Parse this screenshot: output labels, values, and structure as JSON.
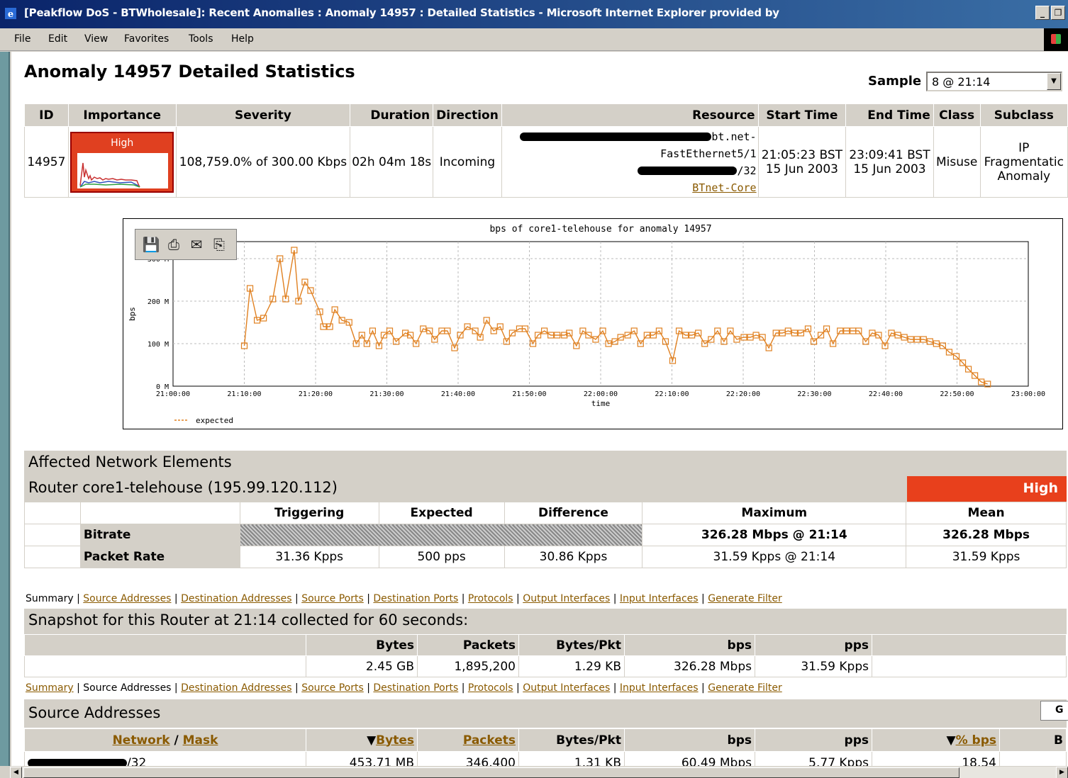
{
  "window": {
    "title": "[Peakflow DoS - BTWholesale]: Recent Anomalies : Anomaly 14957 : Detailed Statistics - Microsoft Internet Explorer provided by",
    "controls": [
      "_",
      "×"
    ]
  },
  "menu": [
    "File",
    "Edit",
    "View",
    "Favorites",
    "Tools",
    "Help"
  ],
  "page": {
    "title": "Anomaly 14957 Detailed Statistics",
    "sample_label": "Sample",
    "sample_value": "8 @ 21:14"
  },
  "anomaly": {
    "headers": [
      "ID",
      "Importance",
      "Severity",
      "Duration",
      "Direction",
      "Resource",
      "Start Time",
      "End Time",
      "Class",
      "Subclass"
    ],
    "id": "14957",
    "importance": "High",
    "severity": "108,759.0% of 300.00 Kbps",
    "duration": "02h 04m 18s",
    "direction": "Incoming",
    "resource_line1": "bt.net-",
    "resource_line2": "FastEthernet5/1",
    "resource_line3": "/32",
    "resource_link": "BTnet-Core",
    "start_time": "21:05:23 BST",
    "start_date": "15 Jun 2003",
    "end_time": "23:09:41 BST",
    "end_date": "15 Jun 2003",
    "class": "Misuse",
    "subclass_1": "IP",
    "subclass_2": "Fragmentatic",
    "subclass_3": "Anomaly"
  },
  "chart_data": {
    "type": "line",
    "title": "bps of core1-telehouse for anomaly 14957",
    "xlabel": "time",
    "ylabel": "bps",
    "y_ticks": [
      "0 M",
      "100 M",
      "200 M",
      "300 M"
    ],
    "x_ticks": [
      "21:00:00",
      "21:10:00",
      "21:20:00",
      "21:30:00",
      "21:40:00",
      "21:50:00",
      "22:00:00",
      "22:10:00",
      "22:20:00",
      "22:30:00",
      "22:40:00",
      "22:50:00",
      "23:00:00"
    ],
    "ylim": [
      0,
      340
    ],
    "xlim_minutes": [
      0,
      120
    ],
    "legend": "expected",
    "series": [
      {
        "color": "#e08020",
        "x_minutes": [
          10,
          10.8,
          11.8,
          12.7,
          14,
          15,
          15.8,
          17,
          17.6,
          18.5,
          19.3,
          20.6,
          21.1,
          22,
          22.7,
          23.7,
          24.7,
          25.7,
          26.5,
          27.2,
          28,
          28.9,
          29.6,
          30.4,
          31.3,
          32.6,
          33.3,
          34.1,
          35.1,
          36,
          36.7,
          37.7,
          38.5,
          39.5,
          40.3,
          41.3,
          42.4,
          43.1,
          44,
          45,
          45.9,
          46.8,
          47.6,
          48.6,
          49.4,
          50.5,
          51.2,
          52.1,
          53,
          53.9,
          54.9,
          55.6,
          56.6,
          57.5,
          58.3,
          59.3,
          60.3,
          61.1,
          62,
          62.8,
          63.8,
          64.7,
          65.6,
          66.5,
          67.4,
          68.2,
          69.1,
          70.1,
          71,
          71.9,
          72.8,
          73.7,
          74.6,
          75.5,
          76.4,
          77.3,
          78.2,
          79.1,
          80.1,
          81,
          81.8,
          82.7,
          83.6,
          84.6,
          85.5,
          86.3,
          87.2,
          88.1,
          89.1,
          89.9,
          90.9,
          91.7,
          92.6,
          93.6,
          94.5,
          95.4,
          96.2,
          97.2,
          98.1,
          99,
          99.9,
          100.8,
          101.7,
          102.6,
          103.5,
          104.4,
          105.3,
          106.2,
          107.1,
          108,
          108.9,
          109.9,
          110.8,
          111.6,
          112.5,
          113.4,
          114.3
        ],
        "values": [
          95,
          230,
          155,
          160,
          205,
          300,
          205,
          320,
          200,
          245,
          225,
          175,
          140,
          140,
          180,
          155,
          150,
          100,
          120,
          100,
          130,
          95,
          120,
          130,
          105,
          125,
          120,
          100,
          135,
          130,
          110,
          130,
          130,
          90,
          120,
          140,
          130,
          115,
          155,
          130,
          140,
          105,
          125,
          135,
          135,
          100,
          120,
          130,
          120,
          120,
          120,
          125,
          95,
          130,
          120,
          110,
          130,
          100,
          105,
          115,
          120,
          130,
          100,
          120,
          120,
          130,
          105,
          60,
          130,
          120,
          120,
          125,
          100,
          110,
          130,
          105,
          130,
          110,
          115,
          115,
          120,
          115,
          90,
          125,
          125,
          130,
          125,
          125,
          135,
          105,
          120,
          135,
          100,
          130,
          130,
          130,
          130,
          105,
          125,
          120,
          95,
          125,
          120,
          115,
          110,
          110,
          110,
          105,
          100,
          95,
          80,
          70,
          55,
          40,
          25,
          10,
          5
        ]
      }
    ]
  },
  "affected": {
    "section_title": "Affected Network Elements",
    "router_title": "Router core1-telehouse (195.99.120.112)",
    "router_importance": "High",
    "headers": [
      "Triggering",
      "Expected",
      "Difference",
      "Maximum",
      "Mean"
    ],
    "rows": [
      {
        "label": "Bitrate",
        "triggering": "",
        "expected": "",
        "difference": "",
        "maximum": "326.28 Mbps @ 21:14",
        "mean": "326.28 Mbps"
      },
      {
        "label": "Packet Rate",
        "triggering": "31.36 Kpps",
        "expected": "500 pps",
        "difference": "30.86 Kpps",
        "maximum": "31.59 Kpps @ 21:14",
        "mean": "31.59 Kpps"
      }
    ]
  },
  "nav1": [
    "Summary",
    "Source Addresses",
    "Destination Addresses",
    "Source Ports",
    "Destination Ports",
    "Protocols",
    "Output Interfaces",
    "Input Interfaces",
    "Generate Filter"
  ],
  "snapshot": {
    "title": "Snapshot for this Router at 21:14 collected for 60 seconds:",
    "headers": [
      "Bytes",
      "Packets",
      "Bytes/Pkt",
      "bps",
      "pps"
    ],
    "values": [
      "2.45 GB",
      "1,895,200",
      "1.29 KB",
      "326.28 Mbps",
      "31.59 Kpps"
    ]
  },
  "nav2": [
    "Summary",
    "Source Addresses",
    "Destination Addresses",
    "Source Ports",
    "Destination Ports",
    "Protocols",
    "Output Interfaces",
    "Input Interfaces",
    "Generate Filter"
  ],
  "source": {
    "title": "Source Addresses",
    "go_label": "G",
    "headers": {
      "network": "Network",
      "slash": "/",
      "mask": "Mask",
      "bytes": "Bytes",
      "packets": "Packets",
      "bpp": "Bytes/Pkt",
      "bps": "bps",
      "pps": "pps",
      "pct": "% bps",
      "last": "B"
    },
    "row": {
      "network_suffix": "/32",
      "bytes": "453.71 MB",
      "packets": "346,400",
      "bpp": "1.31 KB",
      "bps": "60.49 Mbps",
      "pps": "5.77 Kpps",
      "pct": "18.54"
    }
  }
}
